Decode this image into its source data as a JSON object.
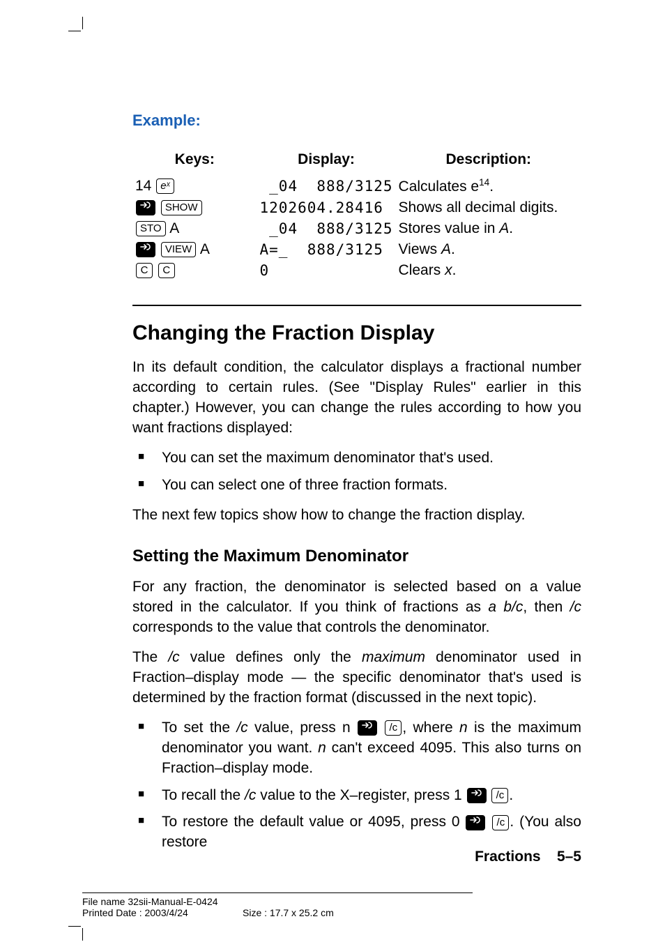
{
  "example_heading": "Example:",
  "table": {
    "headers": {
      "keys": "Keys:",
      "display": "Display:",
      "description": "Description:"
    },
    "rows": [
      {
        "keys_prefix": "14 ",
        "key_labels": [
          "eˣ"
        ],
        "display": " _04  888/3125",
        "desc_pre": "Calculates e",
        "desc_sup": "14",
        "desc_post": "."
      },
      {
        "key_labels": [
          "shift",
          "SHOW"
        ],
        "display": "1202604.28416",
        "desc": "Shows all decimal digits."
      },
      {
        "key_labels": [
          "STO"
        ],
        "keys_suffix": " A",
        "display": " _04  888/3125",
        "desc_pre": "Stores value in ",
        "desc_ital": "A",
        "desc_post": "."
      },
      {
        "key_labels": [
          "shift",
          "VIEW"
        ],
        "keys_suffix": " A",
        "display": "A=_  888/3125",
        "desc_pre": "Views ",
        "desc_ital": "A",
        "desc_post": "."
      },
      {
        "key_labels": [
          "C",
          "C"
        ],
        "display": "0",
        "desc_pre": "Clears ",
        "desc_ital": "x",
        "desc_post": "."
      }
    ]
  },
  "section_heading": "Changing the Fraction Display",
  "intro_para": "In its default condition, the calculator displays a fractional number according to certain rules. (See \"Display Rules\" earlier in this chapter.) However, you can change the rules according to how you want fractions displayed:",
  "intro_bullets": [
    "You can set the maximum denominator that's used.",
    "You can select one of three fraction formats."
  ],
  "intro_after": "The next few topics show how to change the fraction display.",
  "sub_heading": "Setting the Maximum Denominator",
  "p1": {
    "a": "For any fraction, the denominator is selected based on a value stored in the calculator. If you think of fractions as ",
    "i1": "a b/c",
    "b": ", then ",
    "i2": "/c",
    "c": " corresponds to the value that controls the denominator."
  },
  "p2": {
    "a": "The ",
    "i1": "/c",
    "b": " value defines only the ",
    "i2": "maximum",
    "c": " denominator used in Fraction–display mode — the specific denominator that's used is determined by the fraction format (discussed in the next topic)."
  },
  "bullets2": {
    "b1": {
      "a": "To set the ",
      "i1": "/c",
      "b": " value, press n ",
      "keys": [
        "shift",
        "/c"
      ],
      "c": ", where ",
      "i2": "n",
      "d": " is the maximum denominator you want. ",
      "i3": "n",
      "e": " can't exceed 4095. This also turns on Fraction–display mode."
    },
    "b2": {
      "a": "To recall the ",
      "i1": "/c",
      "b": " value to the X–register, press 1 ",
      "keys": [
        "shift",
        "/c"
      ],
      "c": "."
    },
    "b3": {
      "a": "To restore the default value or 4095, press 0 ",
      "keys": [
        "shift",
        "/c"
      ],
      "c": ". (You also restore"
    }
  },
  "page_foot": {
    "chapter": "Fractions",
    "page": "5–5"
  },
  "file_info": {
    "line1": "File name 32sii-Manual-E-0424",
    "line2a": "Printed Date : 2003/4/24",
    "line2b": "Size : 17.7 x 25.2 cm"
  },
  "key_glyphs": {
    "/c": "/c",
    "eˣ": "eˣ",
    "SHOW": "SHOW",
    "STO": "STO",
    "VIEW": "VIEW",
    "C": "C"
  }
}
